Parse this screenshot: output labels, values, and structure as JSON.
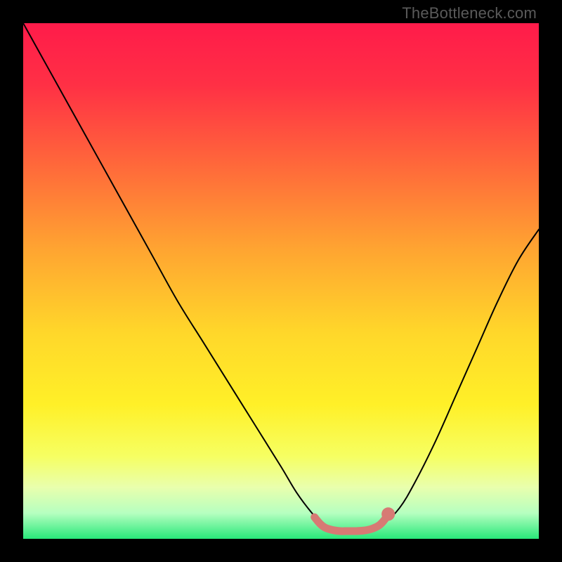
{
  "watermark": "TheBottleneck.com",
  "chart_data": {
    "type": "line",
    "title": "",
    "xlabel": "",
    "ylabel": "",
    "xlim": [
      0,
      100
    ],
    "ylim": [
      0,
      100
    ],
    "background_gradient": {
      "stops": [
        {
          "offset": 0.0,
          "color": "#ff1b4a"
        },
        {
          "offset": 0.12,
          "color": "#ff3045"
        },
        {
          "offset": 0.28,
          "color": "#ff6a3a"
        },
        {
          "offset": 0.44,
          "color": "#ffa531"
        },
        {
          "offset": 0.6,
          "color": "#ffd72a"
        },
        {
          "offset": 0.74,
          "color": "#fff028"
        },
        {
          "offset": 0.84,
          "color": "#f6ff62"
        },
        {
          "offset": 0.9,
          "color": "#e9ffad"
        },
        {
          "offset": 0.95,
          "color": "#b6ffc0"
        },
        {
          "offset": 1.0,
          "color": "#28e87a"
        }
      ]
    },
    "series": [
      {
        "name": "bottleneck-curve",
        "color": "#000000",
        "x": [
          0,
          5,
          10,
          15,
          20,
          25,
          30,
          35,
          40,
          45,
          50,
          53,
          56,
          58,
          60,
          62,
          64,
          66,
          68,
          70,
          73,
          76,
          80,
          84,
          88,
          92,
          96,
          100
        ],
        "y": [
          100,
          91,
          82,
          73,
          64,
          55,
          46,
          38,
          30,
          22,
          14,
          9,
          5,
          3,
          2,
          1.5,
          1.5,
          1.5,
          2,
          3,
          6,
          11,
          19,
          28,
          37,
          46,
          54,
          60
        ]
      }
    ],
    "trough_marker": {
      "color": "#d77a74",
      "points": [
        {
          "x": 56.5,
          "y": 4.2
        },
        {
          "x": 57.5,
          "y": 3.0
        },
        {
          "x": 58.5,
          "y": 2.2
        },
        {
          "x": 60.0,
          "y": 1.7
        },
        {
          "x": 61.5,
          "y": 1.5
        },
        {
          "x": 63.0,
          "y": 1.5
        },
        {
          "x": 64.5,
          "y": 1.5
        },
        {
          "x": 66.0,
          "y": 1.6
        },
        {
          "x": 67.5,
          "y": 1.9
        },
        {
          "x": 69.0,
          "y": 2.6
        },
        {
          "x": 70.0,
          "y": 3.6
        },
        {
          "x": 70.8,
          "y": 4.8
        }
      ],
      "end_dot": {
        "x": 70.8,
        "y": 4.8,
        "r": 1.3
      }
    }
  }
}
